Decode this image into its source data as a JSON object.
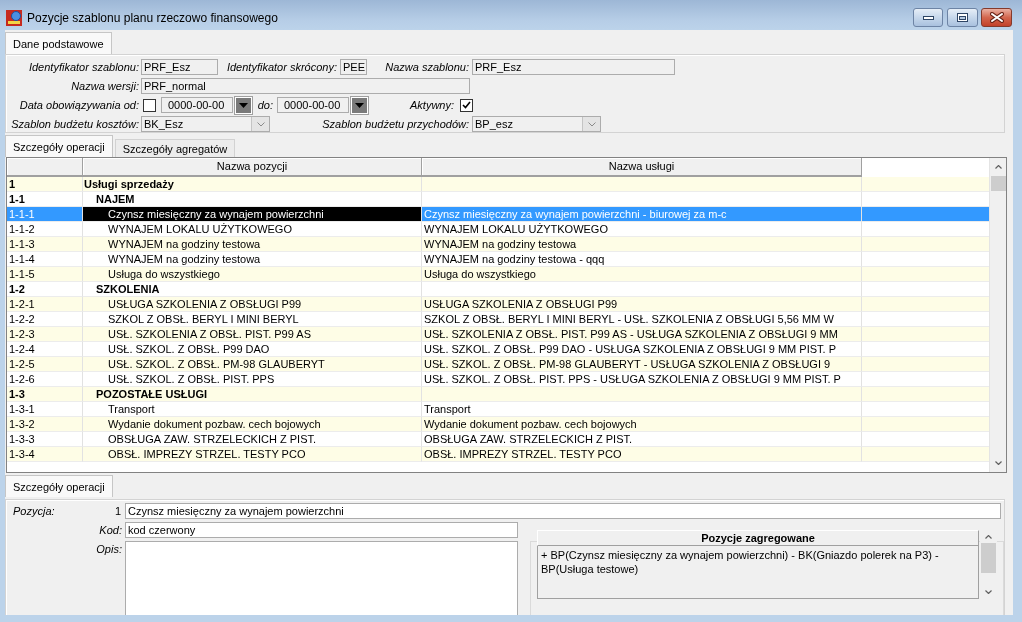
{
  "window": {
    "title": "Pozycje szablonu planu rzeczowo finansowego"
  },
  "header_tabs": [
    {
      "label": "Dane podstawowe",
      "selected": true
    }
  ],
  "basic_form": {
    "rows": [
      {
        "fields": [
          {
            "kind": "text",
            "label": "Identyfikator szablonu:",
            "value": "PRF_Esz"
          },
          {
            "kind": "text",
            "label": "Identyfikator skrócony:",
            "value": "PEE"
          },
          {
            "kind": "text",
            "label": "Nazwa szablonu:",
            "value": "PRF_Esz"
          }
        ]
      },
      {
        "fields": [
          {
            "kind": "text",
            "label": "Nazwa wersji:",
            "value": "PRF_normal"
          }
        ]
      },
      {
        "fields": [
          {
            "kind": "checkbox",
            "label": "Data obowiązywania od:",
            "checked": false
          },
          {
            "kind": "date",
            "value": "0000-00-00"
          },
          {
            "kind": "date",
            "label": "do:",
            "value": "0000-00-00"
          },
          {
            "kind": "checkbox",
            "label": "Aktywny:",
            "checked": true
          }
        ]
      },
      {
        "fields": [
          {
            "kind": "combo",
            "label": "Szablon budżetu kosztów:",
            "value": "BK_Esz"
          },
          {
            "kind": "combo",
            "label": "Szablon budżetu przychodów:",
            "value": "BP_esz"
          }
        ]
      }
    ]
  },
  "table_tabs": [
    {
      "label": "Szczegóły operacji",
      "selected": true
    },
    {
      "label": "Szczegóły agregatów",
      "selected": false
    }
  ],
  "table": {
    "columns": [
      "Nazwa pozycji",
      "Nazwa usługi"
    ],
    "rows": [
      {
        "code": "1",
        "name": "Usługi sprzedaży",
        "selected": false,
        "children": [
          {
            "code": "1-1",
            "name": "NAJEM",
            "selected": false,
            "children": [
              {
                "code": "1-1-1",
                "name": "Czynsz miesięczny za wynajem powierzchni",
                "service": "Czynsz miesięczny za wynajem powierzchni - biurowej za m-c",
                "selected": true
              },
              {
                "code": "1-1-2",
                "name": "WYNAJEM LOKALU UŻYTKOWEGO",
                "service": "WYNAJEM LOKALU UŻYTKOWEGO",
                "selected": false
              },
              {
                "code": "1-1-3",
                "name": "WYNAJEM na godziny testowa",
                "service": "WYNAJEM na godziny testowa",
                "selected": false
              },
              {
                "code": "1-1-4",
                "name": "WYNAJEM na godziny testowa",
                "service": "WYNAJEM na godziny testowa - qqq",
                "selected": false
              },
              {
                "code": "1-1-5",
                "name": "Usługa do wszystkiego",
                "service": "Usługa do wszystkiego",
                "selected": false
              }
            ]
          },
          {
            "code": "1-2",
            "name": "SZKOLENIA",
            "selected": false,
            "children": [
              {
                "code": "1-2-1",
                "name": "USŁUGA SZKOLENIA Z OBSŁUGI P99",
                "service": "USŁUGA SZKOLENIA Z OBSŁUGI P99",
                "selected": false
              },
              {
                "code": "1-2-2",
                "name": "SZKOL Z OBSŁ. BERYL I MINI BERYL",
                "service": "SZKOL Z OBSŁ. BERYL I MINI BERYL - USŁ. SZKOLENIA Z OBSŁUGI 5,56 MM W",
                "selected": false
              },
              {
                "code": "1-2-3",
                "name": "USŁ. SZKOLENIA Z OBSŁ. PIST. P99 AS",
                "service": "USŁ. SZKOLENIA Z OBSŁ. PIST. P99 AS - USŁUGA SZKOLENIA Z OBSŁUGI 9 MM",
                "selected": false
              },
              {
                "code": "1-2-4",
                "name": "USŁ. SZKOL. Z OBSŁ. P99 DAO",
                "service": "USŁ. SZKOL. Z OBSŁ. P99 DAO - USŁUGA SZKOLENIA Z OBSŁUGI 9 MM PIST. P",
                "selected": false
              },
              {
                "code": "1-2-5",
                "name": "USŁ. SZKOL. Z OBSŁ. PM-98 GLAUBERYT",
                "service": "USŁ. SZKOL. Z OBSŁ. PM-98 GLAUBERYT - USŁUGA SZKOLENIA Z OBSŁUGI 9",
                "selected": false
              },
              {
                "code": "1-2-6",
                "name": "USŁ. SZKOL. Z OBSŁ. PIST. PPS",
                "service": "USŁ. SZKOL. Z OBSŁ. PIST. PPS - USŁUGA SZKOLENIA Z OBSŁUGI 9 MM PIST. P",
                "selected": false
              }
            ]
          },
          {
            "code": "1-3",
            "name": "POZOSTAŁE USŁUGI",
            "selected": false,
            "children": [
              {
                "code": "1-3-1",
                "name": "Transport",
                "service": "Transport",
                "selected": false
              },
              {
                "code": "1-3-2",
                "name": "Wydanie dokument pozbaw. cech bojowych",
                "service": "Wydanie dokument pozbaw. cech bojowych",
                "selected": false
              },
              {
                "code": "1-3-3",
                "name": "OBSŁUGA ZAW. STRZELECKICH Z PIST.",
                "service": "OBSŁUGA ZAW. STRZELECKICH Z PIST.",
                "selected": false
              },
              {
                "code": "1-3-4",
                "name": "OBSŁ. IMPREZY STRZEL. TESTY PCO",
                "service": "OBSŁ. IMPREZY STRZEL. TESTY PCO",
                "selected": false
              }
            ]
          }
        ]
      }
    ]
  },
  "detail_tabs": [
    {
      "label": "Szczegóły operacji",
      "selected": true
    }
  ],
  "detail": {
    "position": {
      "label": "Pozycja:",
      "number": "1",
      "value": "Czynsz miesięczny za wynajem powierzchni"
    },
    "code": {
      "label": "Kod:",
      "value": "kod czerwony"
    },
    "description": {
      "label": "Opis:"
    },
    "aggregated": {
      "column": "Pozycje zagregowane",
      "text": "+ BP(Czynsz miesięczny za wynajem powierzchni) - BK(Gniazdo polerek na P3) - BP(Usługa testowe)"
    }
  }
}
